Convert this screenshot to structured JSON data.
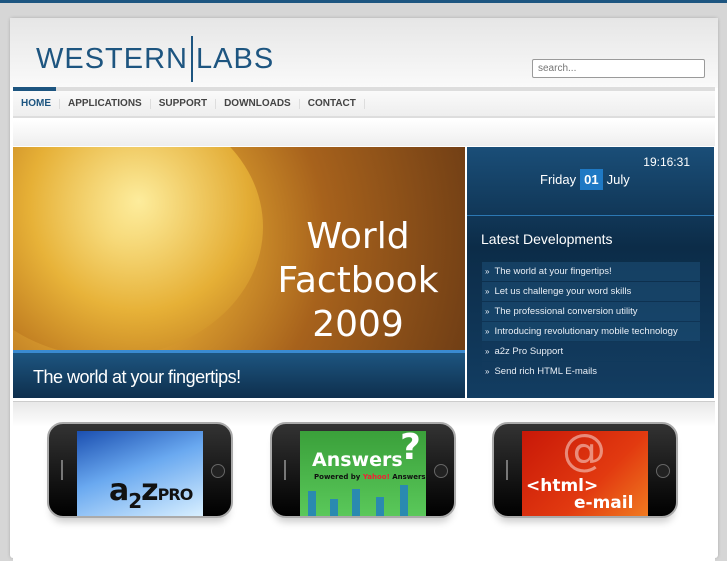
{
  "brand": {
    "left": "WESTERN",
    "right": "LABS"
  },
  "search": {
    "placeholder": "search..."
  },
  "nav": [
    {
      "label": "HOME",
      "active": true
    },
    {
      "label": "APPLICATIONS"
    },
    {
      "label": "SUPPORT"
    },
    {
      "label": "DOWNLOADS"
    },
    {
      "label": "CONTACT"
    }
  ],
  "banner": {
    "title_line1": "World",
    "title_line2": "Factbook",
    "title_line3": "2009",
    "caption": "The world at your fingertips!"
  },
  "clock": {
    "time": "19:16:31",
    "weekday": "Friday",
    "day": "01",
    "month": "July"
  },
  "latest": {
    "title": "Latest Developments",
    "bullet": "»",
    "items": [
      "The world at your fingertips!",
      "Let us challenge your word skills",
      "The professional conversion utility",
      "Introducing revolutionary mobile technology",
      "a2z Pro Support",
      "Send rich HTML E-mails"
    ]
  },
  "products": [
    {
      "name": "a2z PRO",
      "a": "a",
      "two": "2",
      "z": "z",
      "pro": "PRO",
      "color": "#4a8fd8"
    },
    {
      "name": "Answers?",
      "title": "Answers",
      "q": "?",
      "powered": "Powered by",
      "yahoo": "Yahoo!",
      "answers": "Answers",
      "color": "#4cb84a"
    },
    {
      "name": "<html> e-mail",
      "at": "@",
      "line1": "<html>",
      "line2": "e-mail",
      "color": "#d8280e"
    }
  ],
  "colors": {
    "brand": "#1d5580",
    "accent": "#1f79c4"
  }
}
